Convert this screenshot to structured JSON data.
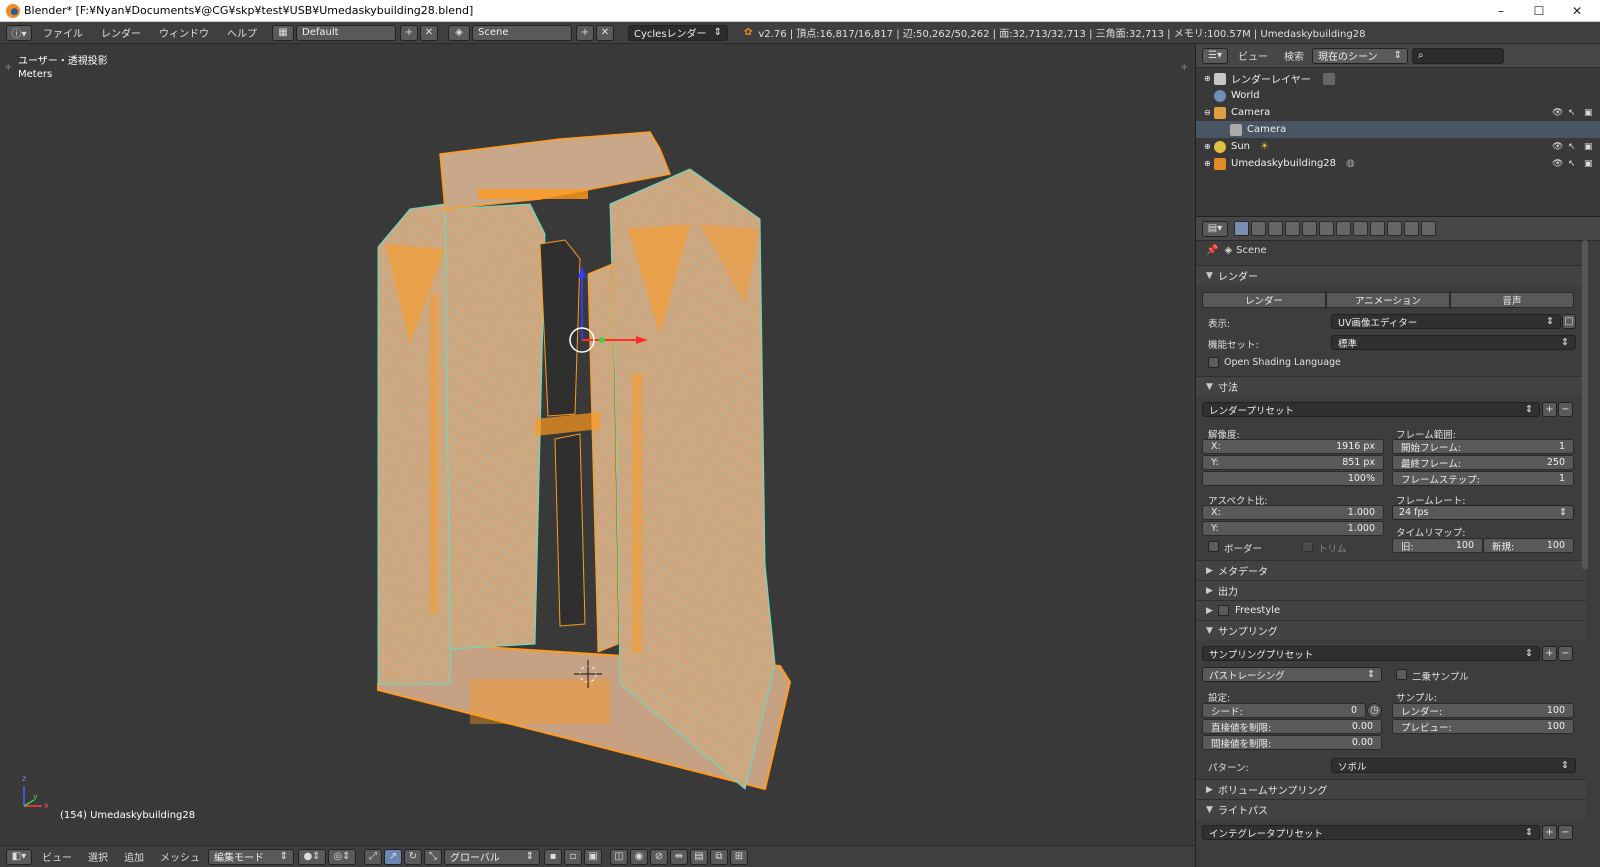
{
  "window": {
    "title": "Blender* [F:¥Nyan¥Documents¥@CG¥skp¥test¥USB¥Umedaskybuilding28.blend]",
    "min": "–",
    "max": "☐",
    "close": "✕"
  },
  "infobar": {
    "menus": [
      "ファイル",
      "レンダー",
      "ウィンドウ",
      "ヘルプ"
    ],
    "screen_layout": "Default",
    "scene": "Scene",
    "engine": "Cyclesレンダー",
    "stats": "v2.76 | 頂点:16,817/16,817 | 辺:50,262/50,262 | 面:32,713/32,713 | 三角面:32,713 | メモリ:100.57M | Umedaskybuilding28"
  },
  "viewport": {
    "view_name": "ユーザー・透視投影",
    "units": "Meters",
    "object_label": "(154) Umedaskybuilding28",
    "axis_x": "x",
    "axis_y": "y",
    "axis_z": "z"
  },
  "bottombar": {
    "menus": [
      "ビュー",
      "選択",
      "追加",
      "メッシュ"
    ],
    "mode": "編集モード",
    "orientation": "グローバル"
  },
  "outliner": {
    "menus": [
      "ビュー",
      "検索"
    ],
    "filter": "現在のシーン",
    "search_placeholder": "",
    "items": [
      {
        "label": "レンダーレイヤー",
        "icon": "render-layers-icon",
        "indent": 0
      },
      {
        "label": "World",
        "icon": "world-icon",
        "indent": 1
      },
      {
        "label": "Camera",
        "icon": "camera-object-icon",
        "indent": 0
      },
      {
        "label": "Camera",
        "icon": "camera-data-icon",
        "indent": 2
      },
      {
        "label": "Sun",
        "icon": "lamp-icon",
        "indent": 0
      },
      {
        "label": "Umedaskybuilding28",
        "icon": "mesh-object-icon",
        "indent": 0
      }
    ]
  },
  "properties": {
    "context": "Scene",
    "render_panel": {
      "title": "レンダー",
      "buttons": [
        "レンダー",
        "アニメーション",
        "音声"
      ],
      "display_label": "表示:",
      "display_value": "UV画像エディター",
      "feature_label": "機能セット:",
      "feature_value": "標準",
      "osl_label": "Open Shading Language"
    },
    "dimensions_panel": {
      "title": "寸法",
      "preset": "レンダープリセット",
      "resolution_label": "解像度:",
      "res_x_label": "X:",
      "res_x": "1916 px",
      "res_y_label": "Y:",
      "res_y": "851 px",
      "res_pct": "100%",
      "frame_range_label": "フレーム範囲:",
      "start_label": "開始フレーム:",
      "start": "1",
      "end_label": "最終フレーム:",
      "end": "250",
      "step_label": "フレームステップ:",
      "step": "1",
      "aspect_label": "アスペクト比:",
      "asp_x_label": "X:",
      "asp_x": "1.000",
      "asp_y_label": "Y:",
      "asp_y": "1.000",
      "framerate_label": "フレームレート:",
      "framerate": "24 fps",
      "timeremap_label": "タイムリマップ:",
      "old_label": "旧:",
      "old": "100",
      "new_label": "新規:",
      "new": "100",
      "border_label": "ボーダー",
      "crop_label": "トリム"
    },
    "collapsed_panels": [
      "メタデータ",
      "出力",
      "Freestyle"
    ],
    "sampling_panel": {
      "title": "サンプリング",
      "preset": "サンプリングプリセット",
      "integrator": "パストレーシング",
      "square_label": "二乗サンプル",
      "settings_label": "設定:",
      "seed_label": "シード:",
      "seed": "0",
      "direct_label": "直接値を制限:",
      "direct": "0.00",
      "indirect_label": "間接値を制限:",
      "indirect": "0.00",
      "samples_label": "サンプル:",
      "render_label": "レンダー:",
      "render": "100",
      "preview_label": "プレビュー:",
      "preview": "100",
      "pattern_label": "パターン:",
      "pattern": "ソボル"
    },
    "volume_panel": "ボリュームサンプリング",
    "lightpath_panel": "ライトパス",
    "integrator_preset": "インテグレータプリセット"
  },
  "colors": {
    "mesh_face": "#c9a88a",
    "mesh_edge": "#ff9a1e",
    "mesh_vertex": "#5fe0c8",
    "viewport_bg": "#393939"
  }
}
